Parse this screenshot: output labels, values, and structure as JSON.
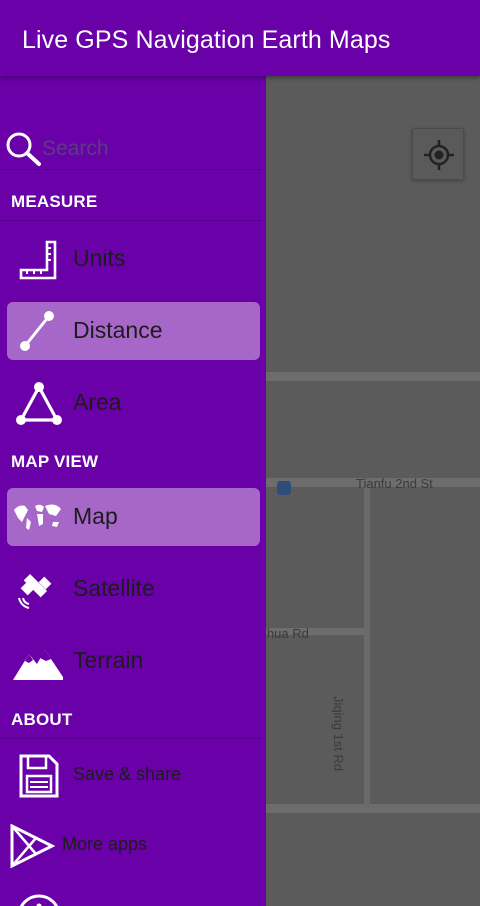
{
  "appbar": {
    "title": "Live GPS Navigation Earth Maps"
  },
  "search": {
    "placeholder": "Search",
    "icon": "search-icon"
  },
  "sections": {
    "measure": "MEASURE",
    "map_view": "MAP VIEW",
    "about": "ABOUT"
  },
  "measure_items": [
    {
      "label": "Units",
      "icon": "ruler-icon",
      "active": false
    },
    {
      "label": "Distance",
      "icon": "line-segment-icon",
      "active": true
    },
    {
      "label": "Area",
      "icon": "triangle-area-icon",
      "active": false
    }
  ],
  "map_view_items": [
    {
      "label": "Map",
      "icon": "world-map-icon",
      "active": true
    },
    {
      "label": "Satellite",
      "icon": "satellite-icon",
      "active": false
    },
    {
      "label": "Terrain",
      "icon": "mountain-icon",
      "active": false
    }
  ],
  "about_items": [
    {
      "label": "Save & share",
      "icon": "floppy-disk-icon"
    },
    {
      "label": "More apps",
      "icon": "play-store-icon"
    }
  ],
  "map": {
    "streets": [
      "Tianfu 2nd St",
      "ihua Rd",
      "Jiqing 1st Rd"
    ],
    "locate_icon": "my-location-icon"
  },
  "colors": {
    "primary": "#6a00a8",
    "active_item": "#a667c8",
    "map_bg": "#5b5b5b"
  }
}
